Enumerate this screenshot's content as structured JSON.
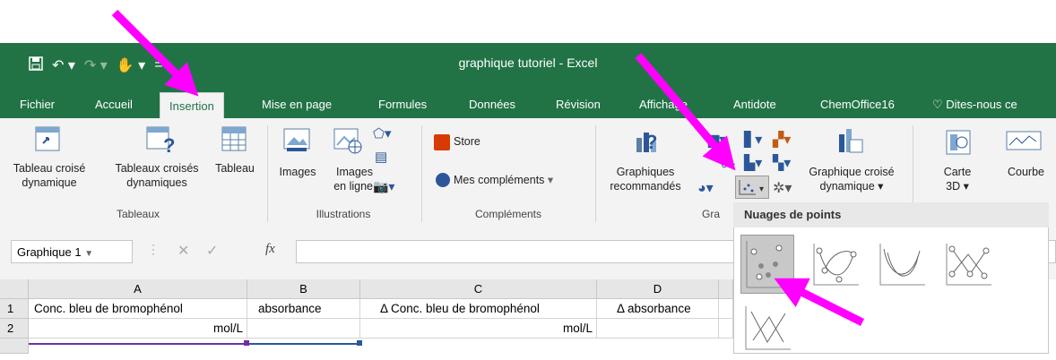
{
  "window": {
    "title": "graphique tutoriel - Excel"
  },
  "tabs": [
    "Fichier",
    "Accueil",
    "Insertion",
    "Mise en page",
    "Formules",
    "Données",
    "Révision",
    "Affichage",
    "Antidote",
    "ChemOffice16"
  ],
  "tell_me": "Dites-nous ce",
  "ribbon": {
    "pivot": {
      "line1": "Tableau croisé",
      "line2": "dynamique"
    },
    "rec_pivot": {
      "line1": "Tableaux croisés",
      "line2": "dynamiques"
    },
    "table": {
      "line1": "Tableau"
    },
    "group_tableaux": "Tableaux",
    "images": {
      "line1": "Images"
    },
    "online_images": {
      "line1": "Images",
      "line2": "en ligne"
    },
    "group_illustrations": "Illustrations",
    "store": "Store",
    "my_addins": "Mes compléments",
    "group_complements": "Compléments",
    "rec_charts": {
      "line1": "Graphiques",
      "line2": "recommandés"
    },
    "group_charts": "Gra",
    "pivot_chart": {
      "line1": "Graphique croisé",
      "line2": "dynamique"
    },
    "map3d": {
      "line1": "Carte",
      "line2": "3D"
    },
    "line": {
      "line1": "Courbe"
    }
  },
  "formula_bar": {
    "name_box": "Graphique 1",
    "fx": "fx"
  },
  "sheet": {
    "columns": [
      "A",
      "B",
      "C",
      "D"
    ],
    "rows": [
      {
        "num": "1",
        "cells": [
          "Conc. bleu de bromophénol",
          "absorbance",
          "Δ Conc. bleu de bromophénol",
          "Δ absorbance"
        ]
      },
      {
        "num": "2",
        "cells": [
          "mol/L",
          "",
          "mol/L",
          ""
        ]
      }
    ]
  },
  "dropdown": {
    "title": "Nuages de points"
  },
  "colors": {
    "excel_green": "#217346",
    "arrow_magenta": "#ff00ff"
  }
}
